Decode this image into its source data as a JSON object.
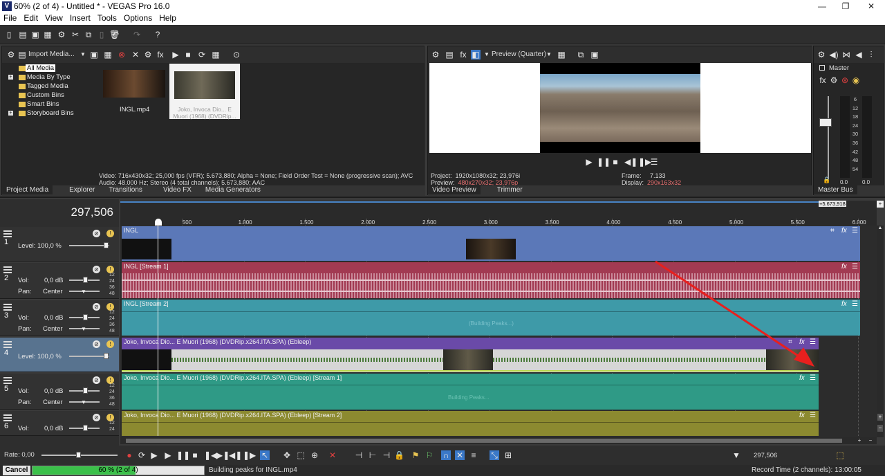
{
  "window": {
    "title": "60% (2 of 4) - Untitled * - VEGAS Pro 16.0",
    "logo": "V",
    "minimize": "—",
    "maximize": "❐",
    "close": "✕"
  },
  "menu": [
    "File",
    "Edit",
    "View",
    "Insert",
    "Tools",
    "Options",
    "Help"
  ],
  "project_media": {
    "import_label": "Import Media...",
    "tree": [
      "All Media",
      "Media By Type",
      "Tagged Media",
      "Custom Bins",
      "Smart Bins",
      "Storyboard Bins"
    ],
    "thumb1_label": "INGL.mp4",
    "thumb2_label": "Joko, Invoca Dio... E Muori (1968) (DVDRip...",
    "info_line1": "Video: 716x430x32; 25,000 fps (VFR); 5.673,880; Alpha = None; Field Order Test = None (progressive scan); AVC",
    "info_line2": "Audio: 48.000 Hz; Stereo (4 total channels); 5.673,880; AAC",
    "tabs": [
      "Project Media",
      "Explorer",
      "Transitions",
      "Video FX",
      "Media Generators"
    ]
  },
  "preview": {
    "mode_label": "Preview (Quarter)",
    "project_label": "Project:",
    "project_value": "1920x1080x32; 23,976i",
    "preview_label": "Preview:",
    "preview_value": "480x270x32; 23,976p",
    "frame_label": "Frame:",
    "frame_value": "7.133",
    "display_label": "Display:",
    "display_value": "290x163x32",
    "tabs": [
      "Video Preview",
      "Trimmer"
    ]
  },
  "master": {
    "label": "Master",
    "tab": "Master Bus",
    "meter_scale": [
      "6",
      "12",
      "18",
      "24",
      "30",
      "36",
      "42",
      "48",
      "54"
    ],
    "meter_values": [
      "0.0",
      "0.0"
    ]
  },
  "timeline": {
    "time_display": "297,506",
    "end_marker": "+5.673,918",
    "ruler": [
      "500",
      "1.000",
      "1.500",
      "2.000",
      "2.500",
      "3.000",
      "3.500",
      "4.000",
      "4.500",
      "5.000",
      "5.500",
      "6.000"
    ],
    "tracks": [
      {
        "num": "1",
        "type": "video",
        "level_label": "Level: 100,0 %",
        "clip_title": "INGL"
      },
      {
        "num": "2",
        "type": "audio",
        "vol_label": "Vol:",
        "vol_value": "0,0 dB",
        "pan_label": "Pan:",
        "pan_value": "Center",
        "clip_title": "INGL [Stream 1]"
      },
      {
        "num": "3",
        "type": "audio",
        "vol_label": "Vol:",
        "vol_value": "0,0 dB",
        "pan_label": "Pan:",
        "pan_value": "Center",
        "clip_title": "INGL [Stream 2]",
        "overlay": "(Building Peaks...)"
      },
      {
        "num": "4",
        "type": "video",
        "level_label": "Level: 100,0 %",
        "clip_title": "Joko, Invoca Dio... E Muori (1968) (DVDRip.x264.ITA.SPA) (Ebleep)"
      },
      {
        "num": "5",
        "type": "audio",
        "vol_label": "Vol:",
        "vol_value": "0,0 dB",
        "pan_label": "Pan:",
        "pan_value": "Center",
        "clip_title": "Joko, Invoca Dio... E Muori (1968) (DVDRip.x264.ITA.SPA) (Ebleep) [Stream 1]",
        "overlay": "Building Peaks..."
      },
      {
        "num": "6",
        "type": "audio",
        "vol_label": "Vol:",
        "vol_value": "0,0 dB",
        "clip_title": "Joko, Invoca Dio... E Muori (1968) (DVDRip.x264.ITA.SPA) (Ebleep) [Stream 2]"
      }
    ],
    "db_scale": [
      "12",
      "24",
      "36",
      "48"
    ],
    "rate_label": "Rate: 0,00",
    "cursor_value": "297,506"
  },
  "status": {
    "cancel_label": "Cancel",
    "progress_text": "60 % (2 of 4)",
    "progress_fraction": 0.6,
    "message": "Building peaks for INGL.mp4",
    "record_time": "Record Time (2 channels): 13:00:05"
  },
  "colors": {
    "video_track": "#5b78b8",
    "audio_red": "#a23a52",
    "audio_teal": "#3e9aa8",
    "video_purple": "#6a4aa8",
    "audio_green": "#2f9a86",
    "audio_olive": "#8c8a30",
    "progress": "#3bc04a",
    "arrow": "#e8201e"
  }
}
